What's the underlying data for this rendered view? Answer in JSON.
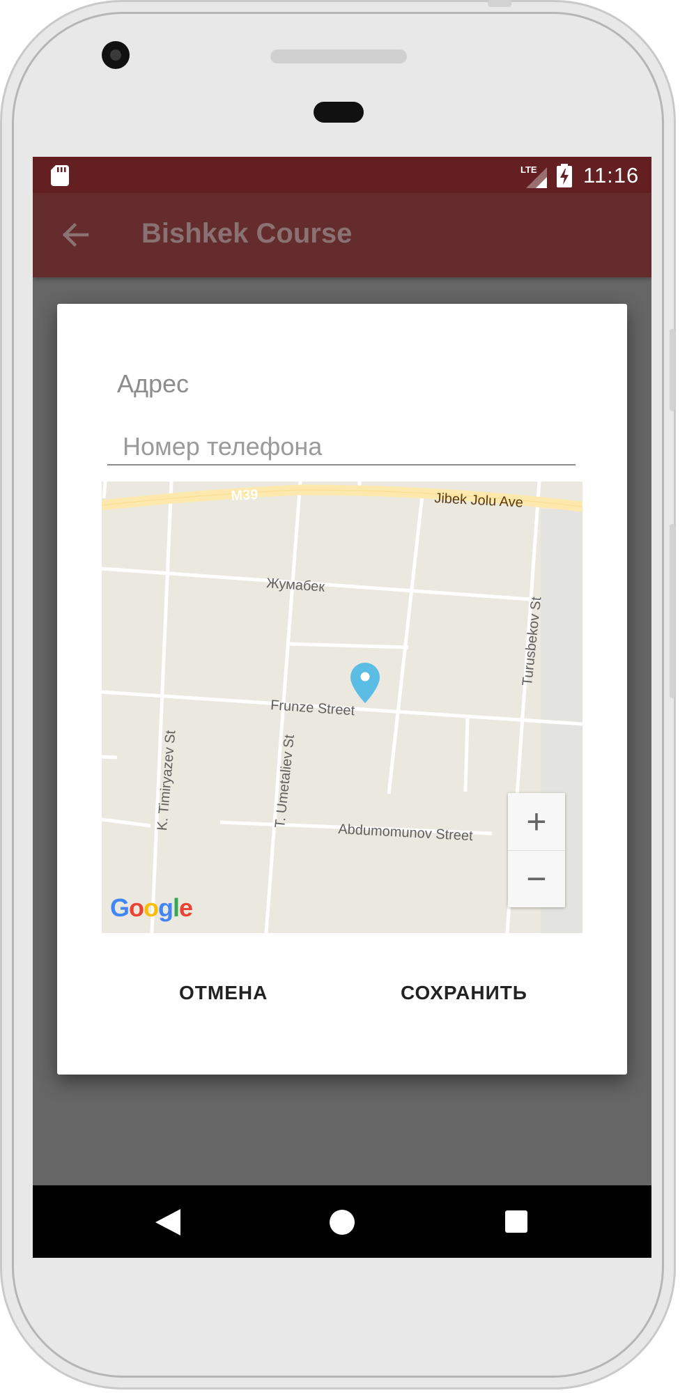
{
  "status_bar": {
    "time": "11:16",
    "network": "LTE",
    "icons": [
      "sd-card-icon",
      "lte-signal-icon",
      "battery-charging-icon"
    ]
  },
  "toolbar": {
    "title": "Bishkek Course",
    "back_icon": "arrow-back-icon"
  },
  "dialog": {
    "address_label": "Адрес",
    "phone_placeholder": "Номер телефона",
    "cancel_label": "ОТМЕНА",
    "save_label": "СОХРАНИТЬ"
  },
  "map": {
    "streets": {
      "m39": "M39",
      "jibek": "Jibek Jolu Ave",
      "zhumabek": "Жумабек",
      "turusbekov": "Turusbekov St",
      "frunze": "Frunze Street",
      "timiryazev": "K. Timiryazev St",
      "umetaliev": "T. Umetaliev St",
      "abdumomunov": "Abdumomunov Street"
    },
    "zoom_in": "+",
    "zoom_out": "−",
    "attribution": [
      "G",
      "o",
      "o",
      "g",
      "l",
      "e"
    ],
    "attribution_colors": [
      "#4285F4",
      "#EA4335",
      "#FBBC05",
      "#4285F4",
      "#34A853",
      "#EA4335"
    ],
    "pin_color": "#5bbde4"
  },
  "nav_bar": {
    "icons": [
      "back-triangle-icon",
      "home-circle-icon",
      "recents-square-icon"
    ]
  },
  "colors": {
    "status_bar": "#631f21",
    "toolbar": "#652c2d",
    "scrim": "#666666"
  }
}
